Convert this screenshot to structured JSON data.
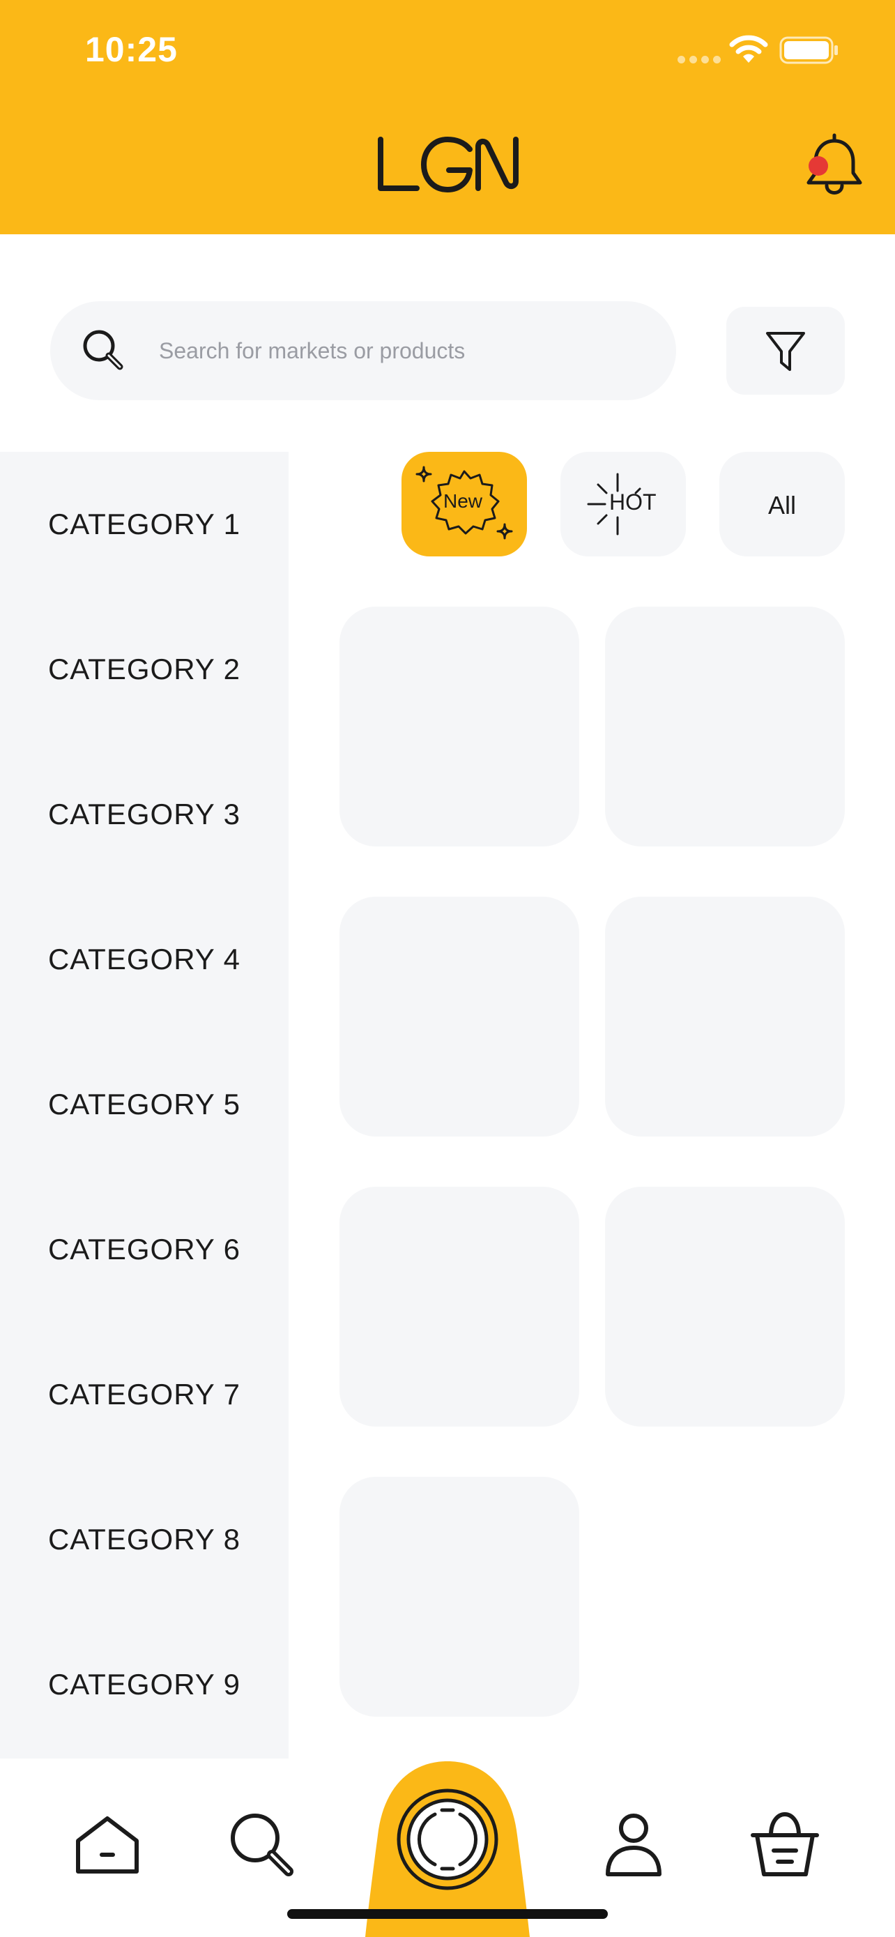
{
  "status_bar": {
    "time": "10:25"
  },
  "header": {
    "logo_text": "LGN",
    "notification_dot_color": "#E53935",
    "background": "#FBB817"
  },
  "search": {
    "placeholder": "Search for markets or products",
    "value": ""
  },
  "filters": [
    {
      "label": "New",
      "selected": true
    },
    {
      "label": "HOT",
      "selected": false
    },
    {
      "label": "All",
      "selected": false
    }
  ],
  "categories": [
    {
      "label": "CATEGORY  1"
    },
    {
      "label": "CATEGORY  2"
    },
    {
      "label": "CATEGORY  3"
    },
    {
      "label": "CATEGORY  4"
    },
    {
      "label": "CATEGORY  5"
    },
    {
      "label": "CATEGORY  6"
    },
    {
      "label": "CATEGORY  7"
    },
    {
      "label": "CATEGORY  8"
    },
    {
      "label": "CATEGORY  9"
    }
  ],
  "product_cards_count": 7,
  "tabbar": {
    "items": [
      {
        "icon": "home-icon"
      },
      {
        "icon": "search-icon"
      },
      {
        "icon": "scan-icon"
      },
      {
        "icon": "profile-icon"
      },
      {
        "icon": "basket-icon"
      }
    ]
  },
  "colors": {
    "accent": "#FBB817",
    "surface": "#F5F6F8",
    "text": "#1b1b1b"
  }
}
